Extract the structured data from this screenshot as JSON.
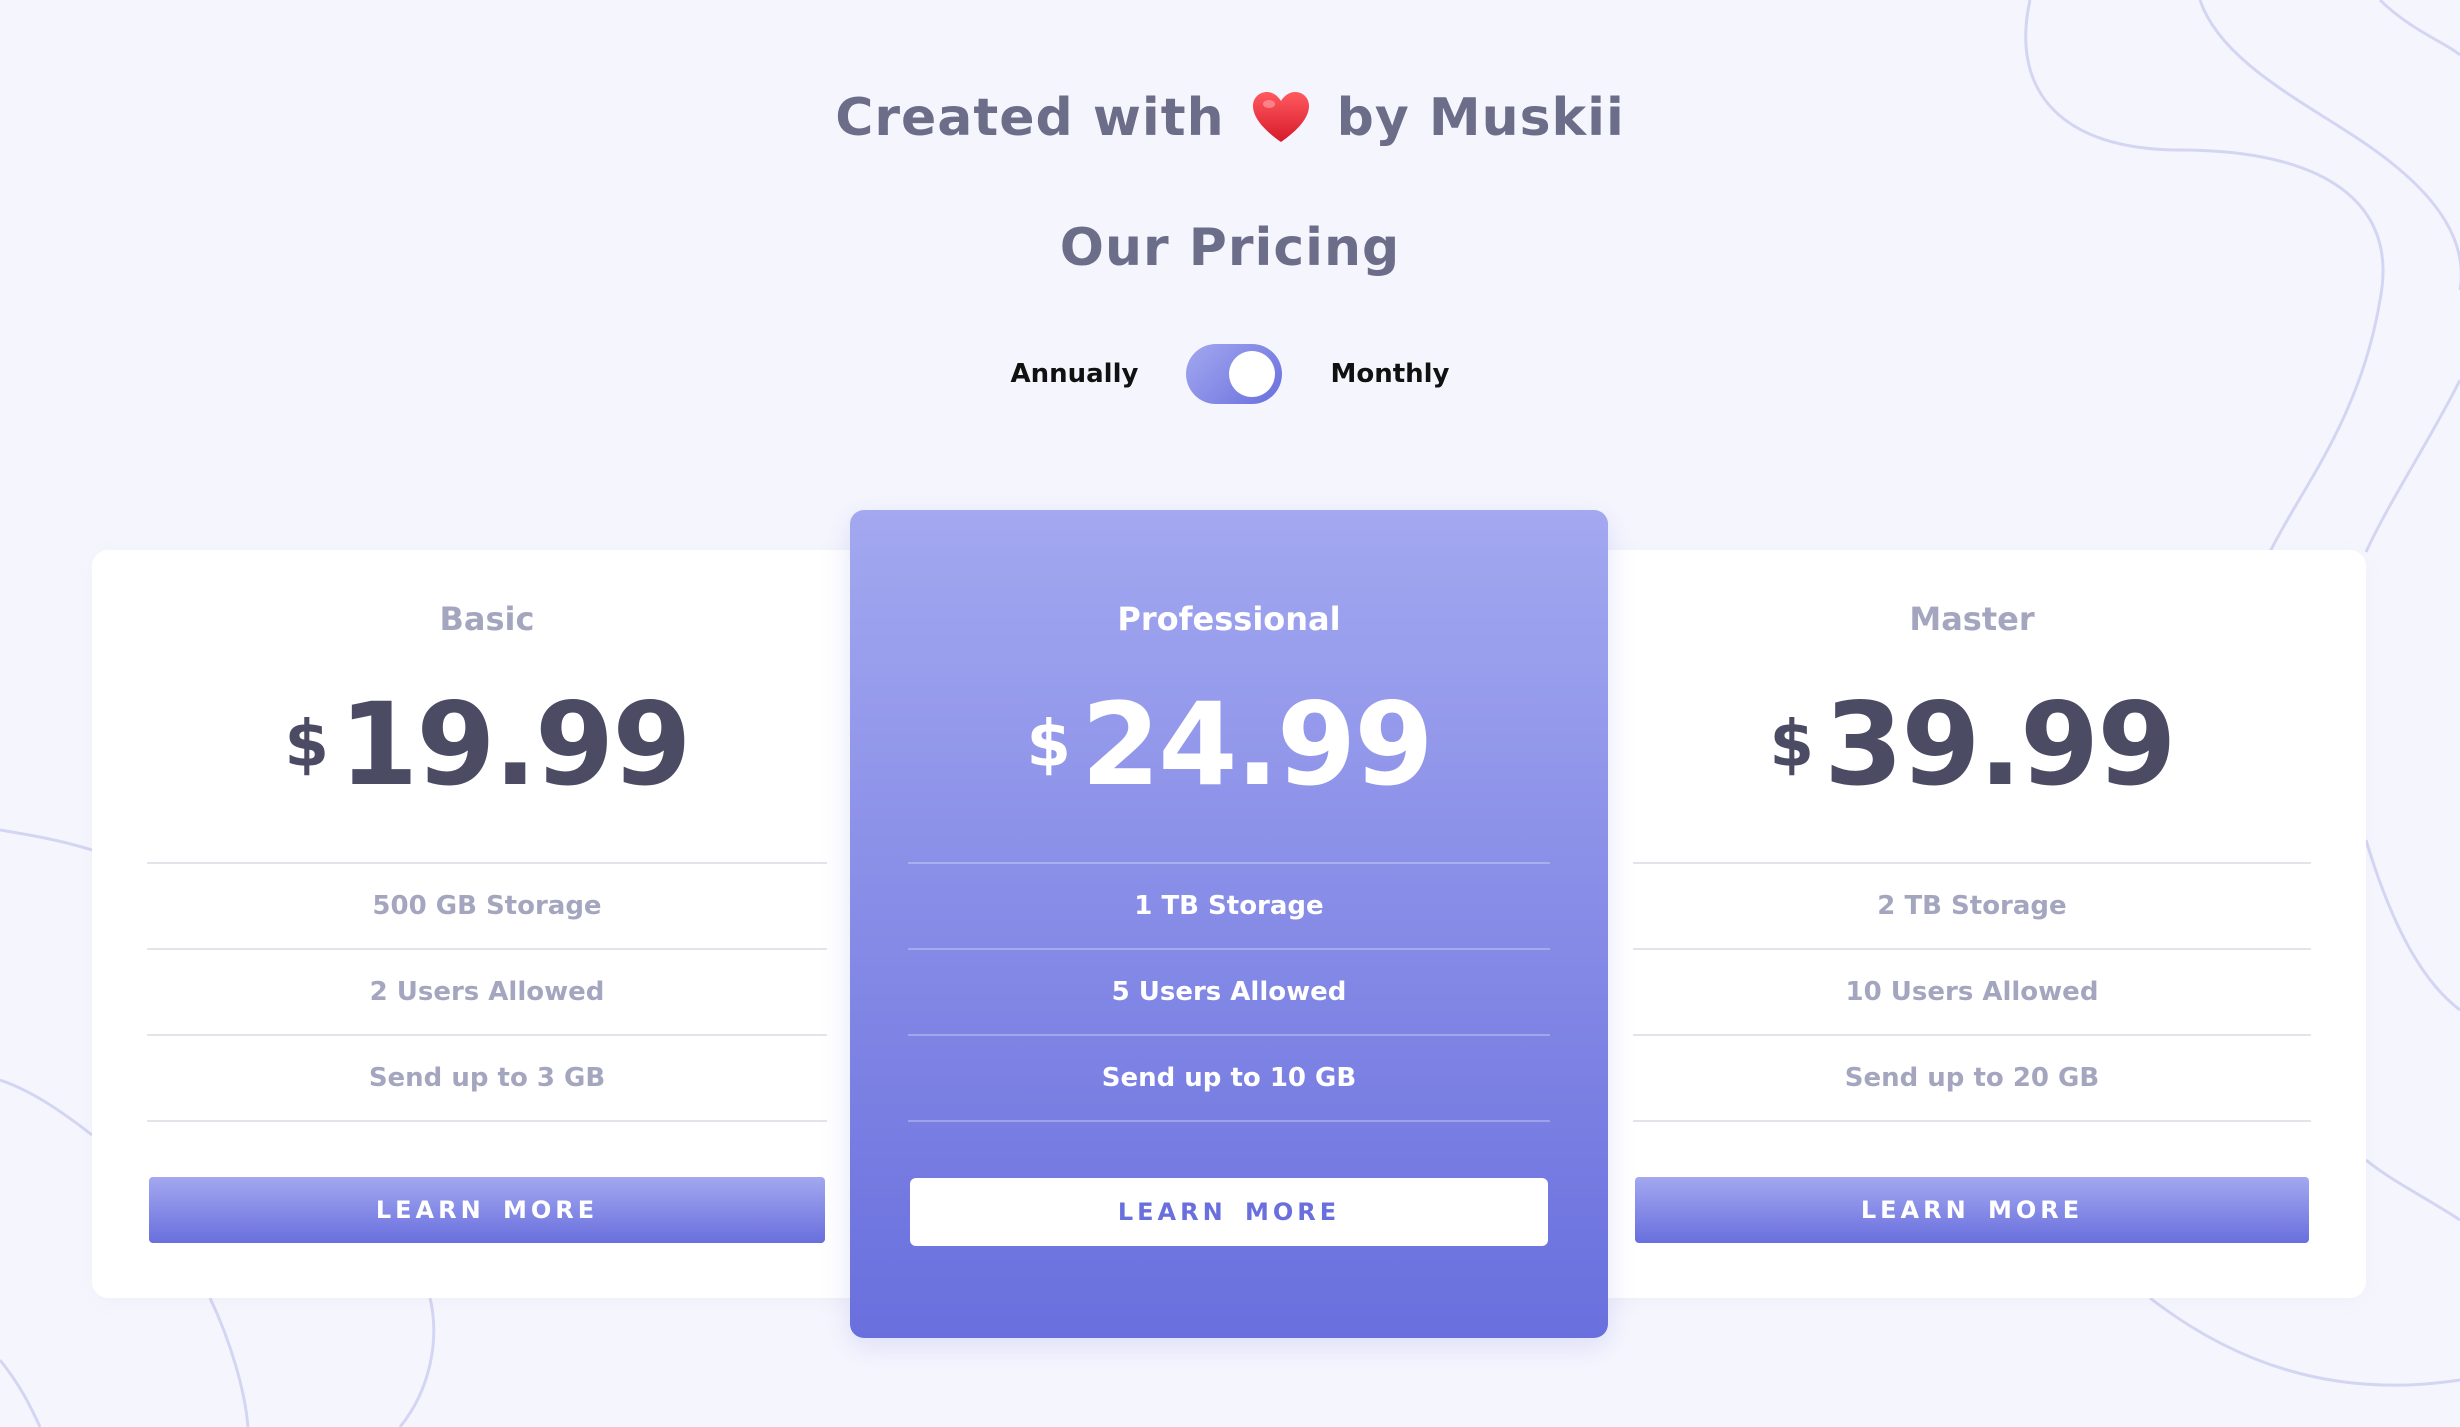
{
  "header": {
    "credit_prefix": "Created with",
    "credit_suffix": "by Muskii",
    "heart_icon": "heart-icon",
    "title": "Our Pricing"
  },
  "billing_toggle": {
    "left_label": "Annually",
    "right_label": "Monthly",
    "selected": "Monthly"
  },
  "colors": {
    "background": "#f5f6fd",
    "accent_light": "#a3a8f0",
    "accent_dark": "#696fdd",
    "heading_text": "#6b6d89",
    "price_text": "#4b4c64",
    "muted_text": "#a4a6bf"
  },
  "plans": [
    {
      "name": "Basic",
      "currency": "$",
      "price": "19.99",
      "features": [
        "500 GB Storage",
        "2 Users Allowed",
        "Send up to 3 GB"
      ],
      "cta": "LEARN MORE"
    },
    {
      "name": "Professional",
      "currency": "$",
      "price": "24.99",
      "features": [
        "1 TB Storage",
        "5 Users Allowed",
        "Send up to 10 GB"
      ],
      "cta": "LEARN MORE"
    },
    {
      "name": "Master",
      "currency": "$",
      "price": "39.99",
      "features": [
        "2 TB Storage",
        "10 Users Allowed",
        "Send up to 20 GB"
      ],
      "cta": "LEARN MORE"
    }
  ]
}
